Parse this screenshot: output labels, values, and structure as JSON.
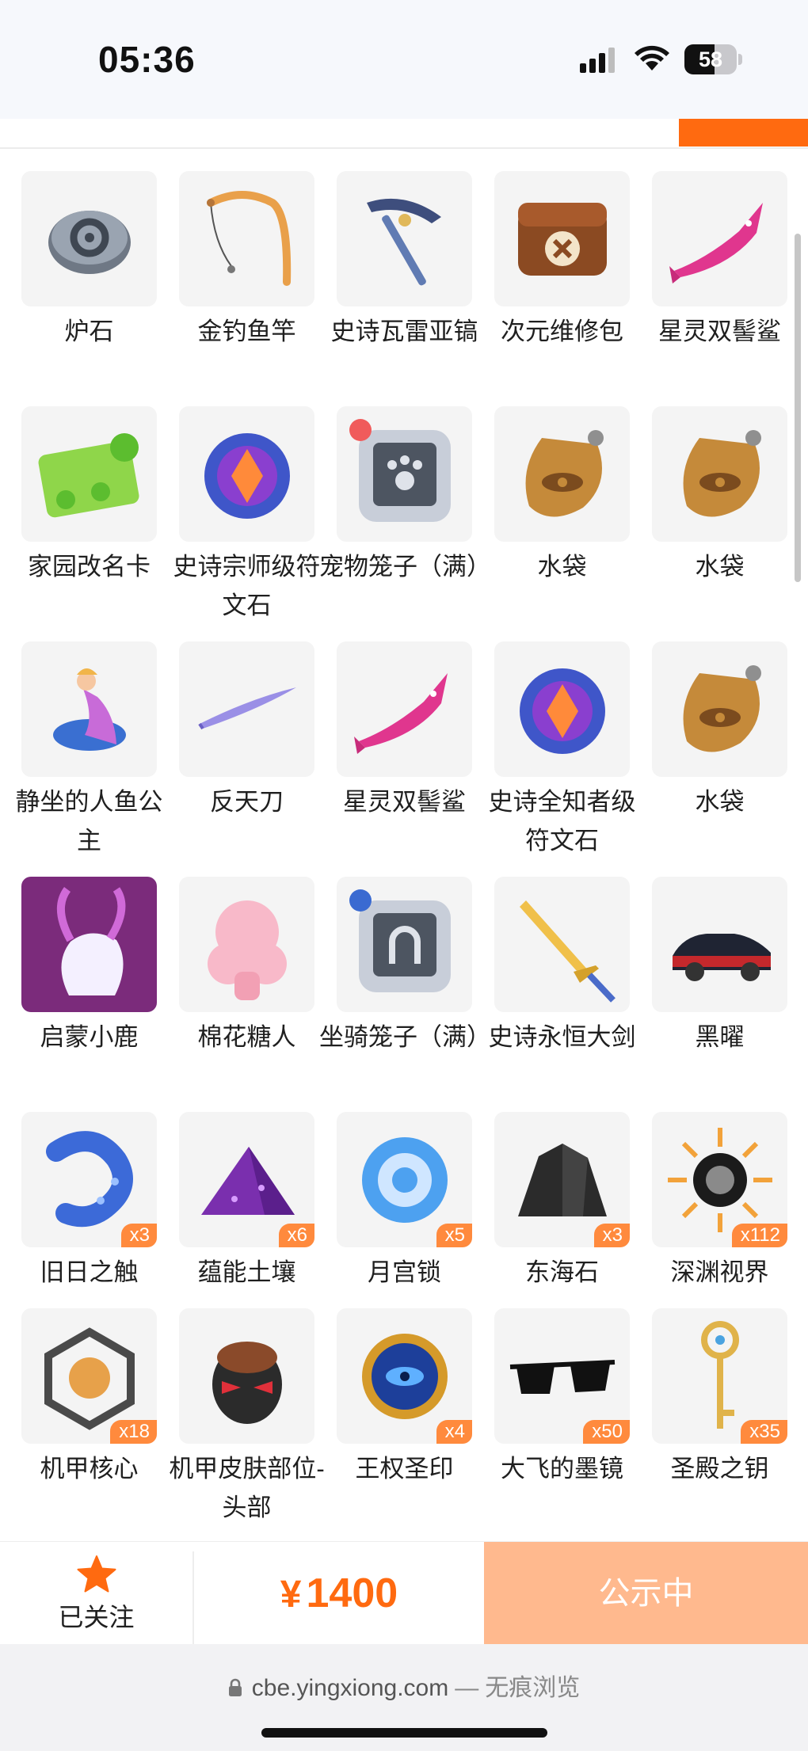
{
  "status_bar": {
    "time": "05:36",
    "battery_level": "58",
    "battery_fraction": 0.58,
    "icons": [
      "signal-icon",
      "wifi-icon",
      "battery-icon"
    ]
  },
  "items": [
    {
      "name": "炉石",
      "qty": "",
      "icon": "hearthstone-icon"
    },
    {
      "name": "金钓鱼竿",
      "qty": "",
      "icon": "fishing-rod-icon"
    },
    {
      "name": "史诗瓦雷亚镐",
      "qty": "",
      "icon": "pickaxe-icon"
    },
    {
      "name": "次元维修包",
      "qty": "",
      "icon": "repair-bag-icon"
    },
    {
      "name": "星灵双髻鲨",
      "qty": "",
      "icon": "hammerhead-shark-icon"
    },
    {
      "name": "家园改名卡",
      "qty": "",
      "icon": "rename-card-icon"
    },
    {
      "name": "史诗宗师级符文石",
      "qty": "",
      "icon": "rune-stone-icon"
    },
    {
      "name": "宠物笼子（满）",
      "qty": "",
      "icon": "pet-cage-icon"
    },
    {
      "name": "水袋",
      "qty": "",
      "icon": "water-bag-icon"
    },
    {
      "name": "水袋",
      "qty": "",
      "icon": "water-bag-icon"
    },
    {
      "name": "静坐的人鱼公主",
      "qty": "",
      "icon": "mermaid-icon"
    },
    {
      "name": "反天刀",
      "qty": "",
      "icon": "blade-icon"
    },
    {
      "name": "星灵双髻鲨",
      "qty": "",
      "icon": "hammerhead-shark-icon"
    },
    {
      "name": "史诗全知者级符文石",
      "qty": "",
      "icon": "rune-stone-icon"
    },
    {
      "name": "水袋",
      "qty": "",
      "icon": "water-bag-icon"
    },
    {
      "name": "启蒙小鹿",
      "qty": "",
      "icon": "deer-icon"
    },
    {
      "name": "棉花糖人",
      "qty": "",
      "icon": "marshmallow-icon"
    },
    {
      "name": "坐骑笼子（满）",
      "qty": "",
      "icon": "mount-cage-icon"
    },
    {
      "name": "史诗永恒大剑",
      "qty": "",
      "icon": "greatsword-icon"
    },
    {
      "name": "黑曜",
      "qty": "",
      "icon": "car-icon"
    },
    {
      "name": "旧日之触",
      "qty": "x3",
      "icon": "tentacle-icon"
    },
    {
      "name": "蕴能土壤",
      "qty": "x6",
      "icon": "soil-icon"
    },
    {
      "name": "月宫锁",
      "qty": "x5",
      "icon": "moon-lock-icon"
    },
    {
      "name": "东海石",
      "qty": "x3",
      "icon": "east-sea-stone-icon"
    },
    {
      "name": "深渊视界",
      "qty": "x112",
      "icon": "abyss-sun-icon"
    },
    {
      "name": "机甲核心",
      "qty": "x18",
      "icon": "mech-core-icon"
    },
    {
      "name": "机甲皮肤部位-头部",
      "qty": "",
      "icon": "mech-helmet-icon"
    },
    {
      "name": "王权圣印",
      "qty": "x4",
      "icon": "royal-seal-icon"
    },
    {
      "name": "大飞的墨镜",
      "qty": "x50",
      "icon": "sunglasses-icon"
    },
    {
      "name": "圣殿之钥",
      "qty": "x35",
      "icon": "temple-key-icon"
    }
  ],
  "bottom_bar": {
    "follow_label": "已关注",
    "price_symbol": "¥",
    "price_value": "1400",
    "status_button": "公示中"
  },
  "browser": {
    "url": "cbe.yingxiong.com",
    "separator": "—",
    "mode": "无痕浏览"
  },
  "colors": {
    "accent": "#ff6a10",
    "status_button_bg": "#ffb98e",
    "qty_badge": "#ff8a3d"
  }
}
